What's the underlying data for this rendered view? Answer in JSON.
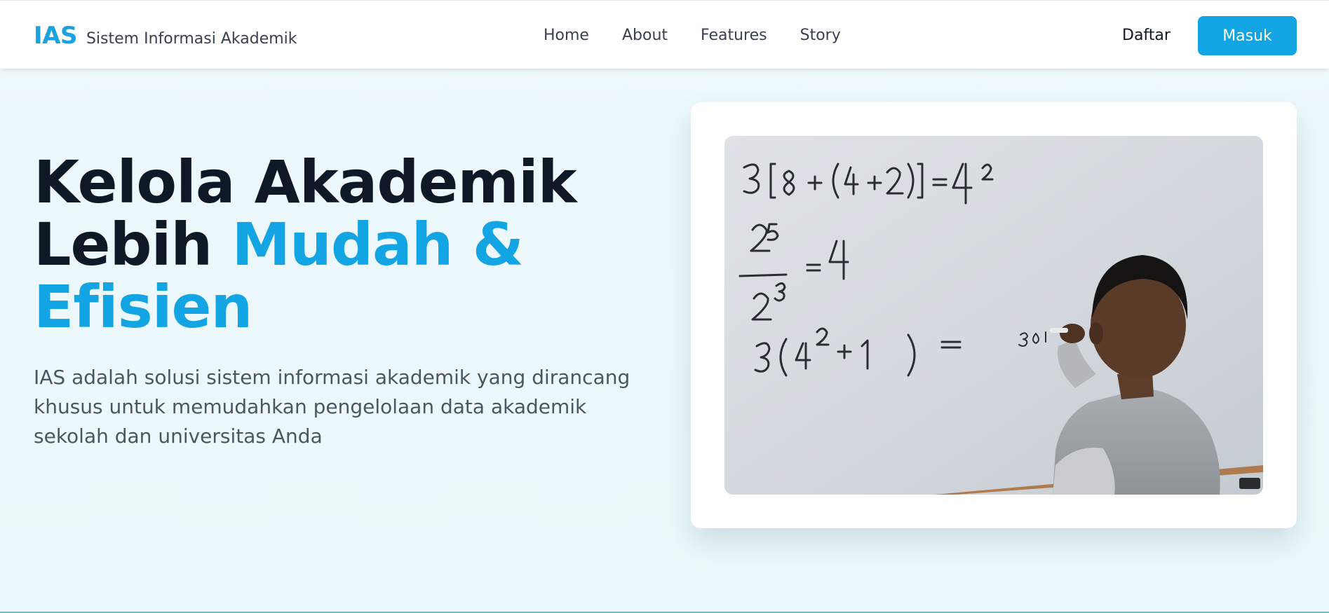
{
  "brand": {
    "logo": "IAS",
    "name": "Sistem Informasi Akademik"
  },
  "nav": {
    "items": [
      {
        "label": "Home"
      },
      {
        "label": "About"
      },
      {
        "label": "Features"
      },
      {
        "label": "Story"
      }
    ]
  },
  "auth": {
    "register_label": "Daftar",
    "login_label": "Masuk"
  },
  "hero": {
    "title_line1": "Kelola Akademik",
    "title_line2_plain": "Lebih ",
    "title_line2_accent": "Mudah &",
    "title_line3_accent": "Efisien",
    "description": "IAS adalah solusi sistem informasi akademik yang dirancang khusus untuk memudahkan pengelolaan data akademik sekolah dan universitas Anda"
  },
  "colors": {
    "accent": "#12a4e3",
    "heading": "#101828",
    "body_text": "#4b5563",
    "background": "#eef8fd"
  }
}
